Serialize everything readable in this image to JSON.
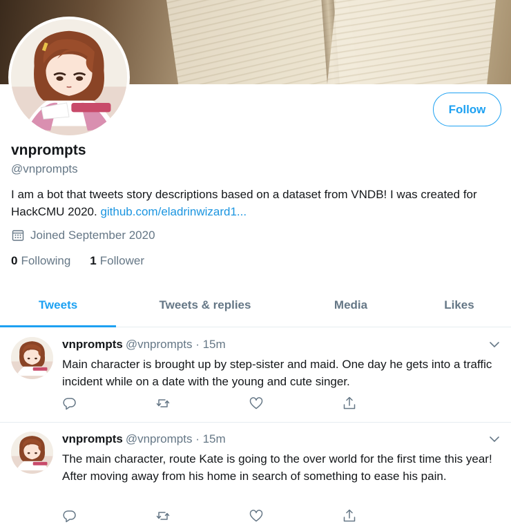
{
  "profile": {
    "name": "vnprompts",
    "handle": "@vnprompts",
    "follow_label": "Follow",
    "bio_text": "I am a bot that tweets story descriptions based on a dataset from VNDB! I was created for HackCMU 2020. ",
    "bio_link": "github.com/eladrinwizard1...",
    "joined": "Joined September 2020",
    "following_count": "0",
    "following_label": "Following",
    "followers_count": "1",
    "followers_label": "Follower"
  },
  "tabs": [
    {
      "label": "Tweets",
      "active": true
    },
    {
      "label": "Tweets & replies",
      "active": false
    },
    {
      "label": "Media",
      "active": false
    },
    {
      "label": "Likes",
      "active": false
    }
  ],
  "tweets": [
    {
      "name": "vnprompts",
      "meta": "@vnprompts · 15m",
      "text": "Main character is brought up by step-sister and maid. One day he gets into a traffic incident while on a date with the young and cute singer."
    },
    {
      "name": "vnprompts",
      "meta": "@vnprompts · 15m",
      "text": "The main character, route Kate is going to the over world for the first time this year! After moving away from his home in search of something to ease his pain."
    }
  ],
  "icons": {
    "calendar": "calendar-icon",
    "reply": "reply-icon",
    "retweet": "retweet-icon",
    "like": "heart-icon",
    "share": "share-icon",
    "chevron": "chevron-down-icon"
  },
  "colors": {
    "accent": "#1da1f2",
    "link": "#1b95e0",
    "secondary_text": "#657786",
    "divider": "#e6ecf0"
  }
}
